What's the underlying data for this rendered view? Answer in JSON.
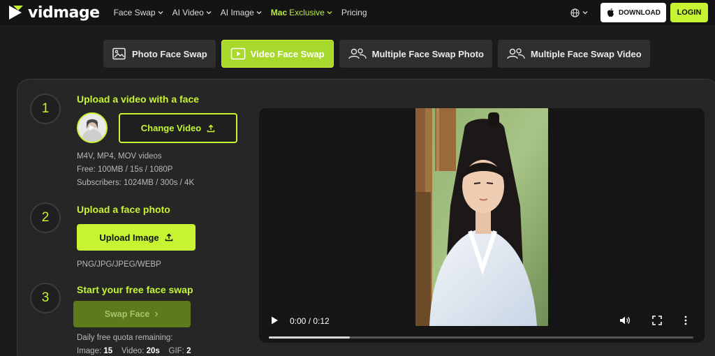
{
  "brand": {
    "name": "vidmage",
    "accent": "#c6f432"
  },
  "nav": {
    "items": [
      {
        "label": "Face Swap",
        "dropdown": true
      },
      {
        "label": "AI Video",
        "dropdown": true
      },
      {
        "label": "AI Image",
        "dropdown": true
      },
      {
        "label_strong": "Mac",
        "label_rest": "Exclusive",
        "dropdown": true
      },
      {
        "label": "Pricing",
        "dropdown": false
      }
    ],
    "download_label": "DOWNLOAD",
    "login_label": "LOGIN"
  },
  "tabs": [
    {
      "label": "Photo Face Swap",
      "icon": "image-icon",
      "active": false
    },
    {
      "label": "Video Face Swap",
      "icon": "play-icon",
      "active": true
    },
    {
      "label": "Multiple Face Swap Photo",
      "icon": "multi-face-icon",
      "active": false
    },
    {
      "label": "Multiple Face Swap Video",
      "icon": "multi-face-icon",
      "active": false
    }
  ],
  "steps": {
    "one": {
      "number": "1",
      "title": "Upload a video with a face",
      "button": "Change Video",
      "info": [
        "M4V, MP4, MOV videos",
        "Free: 100MB / 15s / 1080P",
        "Subscribers: 1024MB / 300s / 4K"
      ]
    },
    "two": {
      "number": "2",
      "title": "Upload a face photo",
      "button": "Upload Image",
      "info": "PNG/JPG/JPEG/WEBP"
    },
    "three": {
      "number": "3",
      "title": "Start your free face swap",
      "button": "Swap Face",
      "quota_label": "Daily free quota remaining:",
      "quota": {
        "image_label": "Image:",
        "image_value": "15",
        "video_label": "Video:",
        "video_value": "20s",
        "gif_label": "GIF:",
        "gif_value": "2"
      }
    }
  },
  "video": {
    "time": "0:00 / 0:12",
    "progress_fraction": 0.19
  }
}
